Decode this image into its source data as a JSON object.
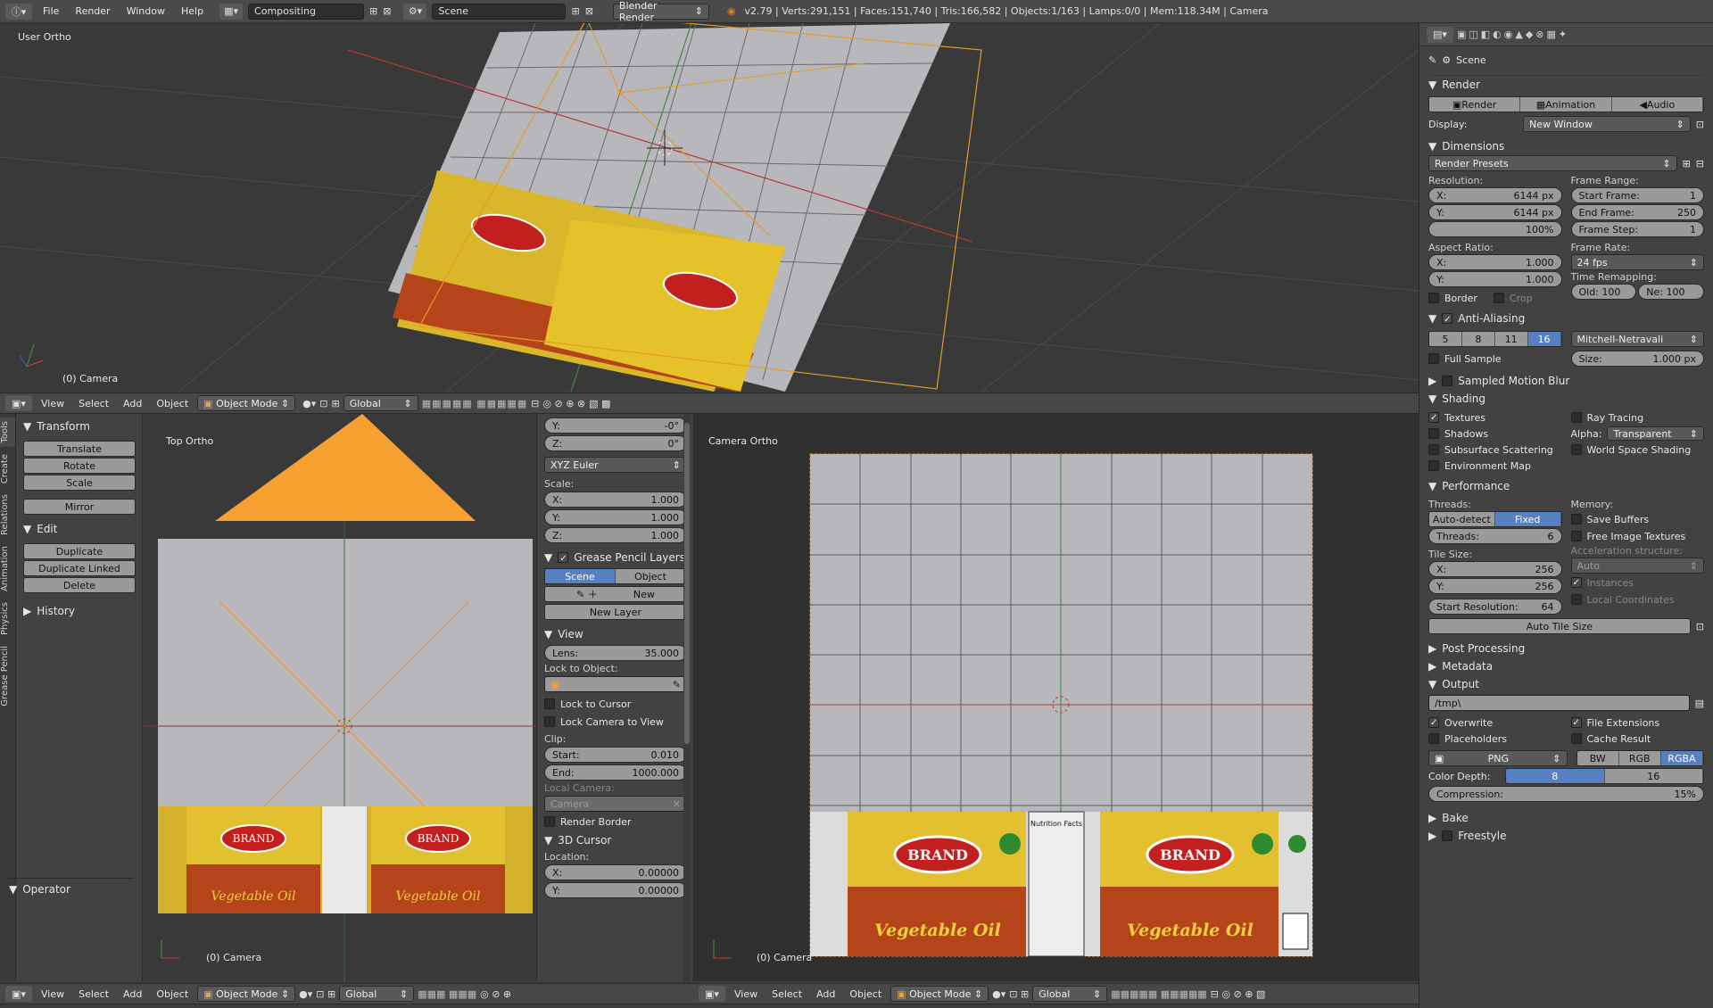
{
  "topbar": {
    "menus": [
      "File",
      "Render",
      "Window",
      "Help"
    ],
    "screen_layout": "Compositing",
    "scene": "Scene",
    "engine": "Blender Render",
    "stats": "v2.79 | Verts:291,151 | Faces:151,740 | Tris:166,582 | Objects:1/163 | Lamps:0/0 | Mem:118.34M | Camera"
  },
  "viewport_top": {
    "label": "User Ortho",
    "object": "(0) Camera"
  },
  "header3d": {
    "menus": [
      "View",
      "Select",
      "Add",
      "Object"
    ],
    "mode": "Object Mode",
    "orientation": "Global"
  },
  "toolshelf": {
    "tabs": [
      "Tools",
      "Create",
      "Relations",
      "Animation",
      "Physics",
      "Grease Pencil"
    ],
    "transform_title": "Transform",
    "transform_buttons": [
      "Translate",
      "Rotate",
      "Scale",
      "Mirror"
    ],
    "edit_title": "Edit",
    "edit_buttons": [
      "Duplicate",
      "Duplicate Linked",
      "Delete"
    ],
    "history_title": "History",
    "operator_title": "Operator"
  },
  "viewport_left": {
    "label": "Top Ortho",
    "object": "(0) Camera"
  },
  "npanel": {
    "rot_y_label": "Y:",
    "rot_y": "-0°",
    "rot_z_label": "Z:",
    "rot_z": "0°",
    "rot_mode": "XYZ Euler",
    "scale_label": "Scale:",
    "scale": [
      {
        "k": "X:",
        "v": "1.000"
      },
      {
        "k": "Y:",
        "v": "1.000"
      },
      {
        "k": "Z:",
        "v": "1.000"
      }
    ],
    "gp_title": "Grease Pencil Layers",
    "gp_scene": "Scene",
    "gp_object": "Object",
    "gp_new": "New",
    "gp_newlayer": "New Layer",
    "view_title": "View",
    "lens_label": "Lens:",
    "lens": "35.000",
    "lock_obj": "Lock to Object:",
    "lock_cursor": "Lock to Cursor",
    "lock_camera": "Lock Camera to View",
    "clip": "Clip:",
    "clip_start_label": "Start:",
    "clip_start": "0.010",
    "clip_end_label": "End:",
    "clip_end": "1000.000",
    "local_camera": "Local Camera:",
    "camera_ph": "Camera",
    "render_border": "Render Border",
    "cursor_title": "3D Cursor",
    "location": "Location:",
    "loc_x_label": "X:",
    "loc_x": "0.00000",
    "loc_y_label": "Y:",
    "loc_y": "0.00000"
  },
  "viewport_right": {
    "label": "Camera Ortho",
    "object": "(0) Camera"
  },
  "label_art": {
    "brand": "BRAND",
    "product": "Vegetable Oil",
    "nutrition": "Nutrition Facts"
  },
  "props": {
    "scene": "Scene",
    "render_title": "Render",
    "render_btns": [
      "Render",
      "Animation",
      "Audio"
    ],
    "display_label": "Display:",
    "display_value": "New Window",
    "dimensions_title": "Dimensions",
    "render_presets": "Render Presets",
    "resolution": "Resolution:",
    "res_x_label": "X:",
    "res_x": "6144 px",
    "res_y_label": "Y:",
    "res_y": "6144 px",
    "res_pct": "100%",
    "aspect": "Aspect Ratio:",
    "asp_x_label": "X:",
    "asp_x": "1.000",
    "asp_y_label": "Y:",
    "asp_y": "1.000",
    "border": "Border",
    "crop": "Crop",
    "frame_range": "Frame Range:",
    "start_frame_label": "Start Frame:",
    "start_frame": "1",
    "end_frame_label": "End Frame:",
    "end_frame": "250",
    "frame_step_label": "Frame Step:",
    "frame_step": "1",
    "frame_rate": "Frame Rate:",
    "fps": "24 fps",
    "time_remap": "Time Remapping:",
    "old": "Old: 100",
    "new": "Ne: 100",
    "aa_title": "Anti-Aliasing",
    "aa_samples": [
      "5",
      "8",
      "11",
      "16"
    ],
    "aa_filter": "Mitchell-Netravali",
    "full_sample": "Full Sample",
    "aa_size_label": "Size:",
    "aa_size": "1.000 px",
    "motion_blur": "Sampled Motion Blur",
    "shading_title": "Shading",
    "textures": "Textures",
    "shadows": "Shadows",
    "sss": "Subsurface Scattering",
    "env_map": "Environment Map",
    "ray_tracing": "Ray Tracing",
    "alpha_label": "Alpha:",
    "alpha": "Transparent",
    "world_space": "World Space Shading",
    "perf_title": "Performance",
    "threads": "Threads:",
    "autodetect": "Auto-detect",
    "fixed": "Fixed",
    "threads_count_label": "Threads:",
    "threads_count": "6",
    "tile_size": "Tile Size:",
    "tile_x_label": "X:",
    "tile_x": "256",
    "tile_y_label": "Y:",
    "tile_y": "256",
    "start_res_label": "Start Resolution:",
    "start_res": "64",
    "memory": "Memory:",
    "save_buffers": "Save Buffers",
    "free_tex": "Free Image Textures",
    "accel": "Acceleration structure:",
    "accel_val": "Auto",
    "instances": "Instances",
    "local_coords": "Local Coordinates",
    "auto_tile": "Auto Tile Size",
    "post_title": "Post Processing",
    "meta_title": "Metadata",
    "output_title": "Output",
    "output_path": "/tmp\\",
    "overwrite": "Overwrite",
    "file_ext": "File Extensions",
    "placeholders": "Placeholders",
    "cache_result": "Cache Result",
    "format": "PNG",
    "color_modes": [
      "BW",
      "RGB",
      "RGBA"
    ],
    "color_depth_label": "Color Depth:",
    "depth": [
      "8",
      "16"
    ],
    "compression_label": "Compression:",
    "compression": "15%",
    "bake_title": "Bake",
    "freestyle_title": "Freestyle"
  }
}
